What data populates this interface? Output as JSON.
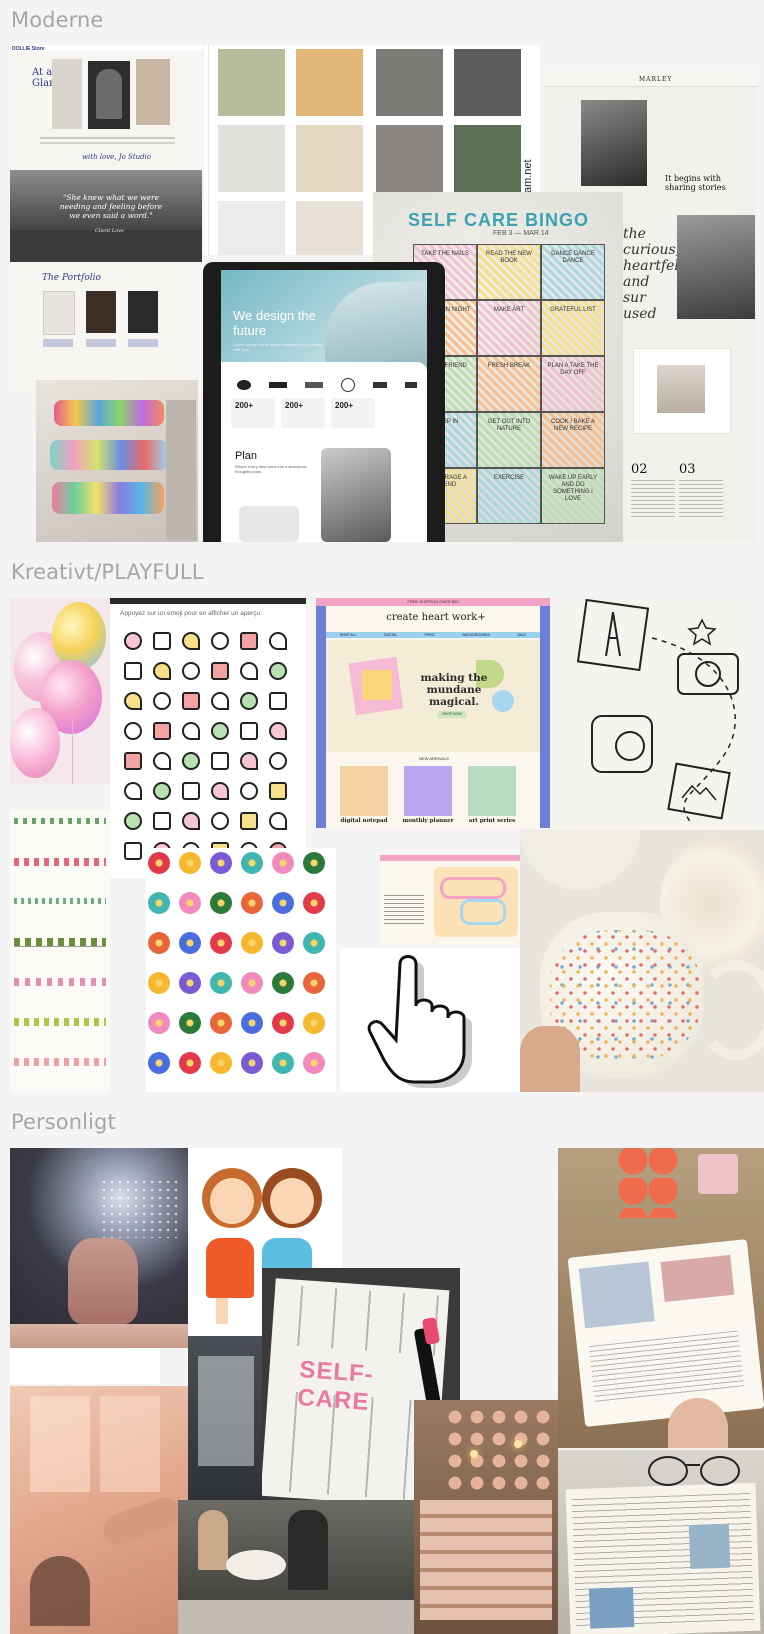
{
  "sections": {
    "moderne": {
      "title": "Moderne",
      "portfolio": {
        "brand": "DOLLIE Store",
        "heading": "At a Glance",
        "script_line": "with love, Jo Studio",
        "quote": "\"She knew what we were needing and feeling before we even said a word.\"",
        "quote_sign": "Client Love",
        "portfolio_heading": "The Portfolio"
      },
      "palette": {
        "side_text": "cameronteam.net",
        "colors": [
          "#b9bc9c",
          "#e3b77a",
          "#7c7b78",
          "#5d5d5c",
          "#e0e0dd",
          "#e6d9c6",
          "#8a8580",
          "#5b6f55",
          "#ebebe9",
          "#e8e1d8"
        ]
      },
      "magazine": {
        "logo": "MARLEY",
        "headline": "It begins with sharing stories",
        "num1": "02",
        "num2": "03"
      },
      "bingo": {
        "title": "SELF CARE BINGO",
        "subtitle": "FEB 3 — MAR 14",
        "cells": [
          "TAKE THE NAILS",
          "READ THE NEW BOOK",
          "DANCE DANCE DANCE",
          "POPCORN NIGHT",
          "MAKE ART",
          "GRATEFUL LIST",
          "CALL A FRIEND",
          "FRESH BREAK",
          "PLAN A TAKE THE DAY OFF",
          "SLEEP IN",
          "GET OUT INTO NATURE",
          "COOK / BAKE A NEW RECIPE",
          "ENCOURAGE A FRIEND",
          "EXERCISE",
          "WAKE UP EARLY AND DO SOMETHING I LOVE"
        ]
      },
      "tablet": {
        "headline": "We design the future",
        "subline": "Lorem ipsum text of studio designers work, crafted with care.",
        "stats": [
          "200+",
          "200+",
          "200+"
        ],
        "plan_title": "Plan",
        "plan_text": "Where every idea turns into a structured, thoughtful plan."
      }
    },
    "playfull": {
      "title": "Kreativt/PLAYFULL",
      "emoji_caption": "Appuyez sur un emoji pour en afficher un aperçu",
      "shop": {
        "banner": "FREE SHIPPING OVER $50",
        "brand": "create heart work+",
        "nav": [
          "SHOP ALL",
          "DIGITAL",
          "PRINT",
          "BACKGROUNDS",
          "SALE"
        ],
        "hero": "making the mundane magical.",
        "hero_button": "SHOP NOW",
        "collections_label": "NEW ARRIVALS",
        "products": [
          "digital notepad",
          "monthly planner",
          "art print series"
        ]
      },
      "flower_caption": "flowers_...raw_flo.png"
    },
    "personligt": {
      "title": "Personligt",
      "selfcare_word": "SELF-CARE"
    }
  },
  "colors": {
    "page_bg": "#f4f4f5",
    "title_gray": "#a6a6a6"
  }
}
